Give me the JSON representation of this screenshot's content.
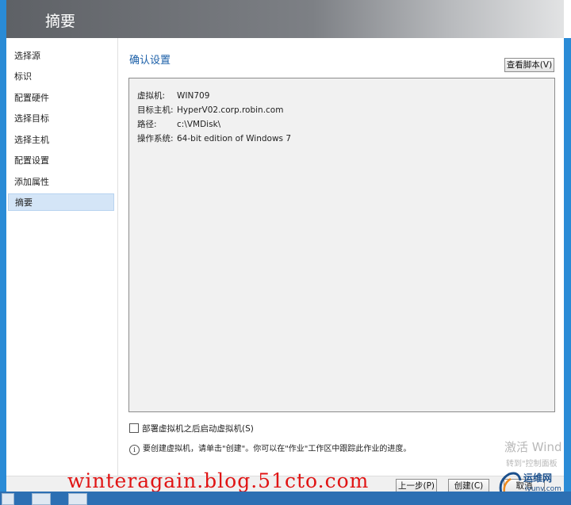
{
  "window": {
    "title": "摘要"
  },
  "nav": {
    "items": [
      {
        "label": "选择源"
      },
      {
        "label": "标识"
      },
      {
        "label": "配置硬件"
      },
      {
        "label": "选择目标"
      },
      {
        "label": "选择主机"
      },
      {
        "label": "配置设置"
      },
      {
        "label": "添加属性"
      },
      {
        "label": "摘要",
        "active": true
      }
    ]
  },
  "main": {
    "section_title": "确认设置",
    "view_script_label": "查看脚本(V)",
    "summary": [
      {
        "label": "虚拟机:",
        "value": "WIN709"
      },
      {
        "label": "目标主机:",
        "value": "HyperV02.corp.robin.com"
      },
      {
        "label": "路径:",
        "value": "c:\\VMDisk\\"
      },
      {
        "label": "操作系统:",
        "value": "64-bit edition of Windows 7"
      }
    ],
    "start_vm_checkbox": {
      "label": "部署虚拟机之后启动虚拟机(S)",
      "checked": false
    },
    "info_text": "要创建虚拟机，请单击\"创建\"。你可以在\"作业\"工作区中跟踪此作业的进度。"
  },
  "footer": {
    "prev_label": "上一步(P)",
    "create_label": "创建(C)",
    "cancel_label": "取消"
  },
  "overlays": {
    "watermark_url": "winteragain.blog.51cto.com",
    "activate_title": "激活 Wind",
    "activate_sub": "转到\"控制面板",
    "logo_text": "运维网",
    "logo_url": "iyunv.com"
  },
  "colors": {
    "accent": "#2a8bd6",
    "title_blue": "#1b5fa8",
    "watermark": "#e01414"
  }
}
